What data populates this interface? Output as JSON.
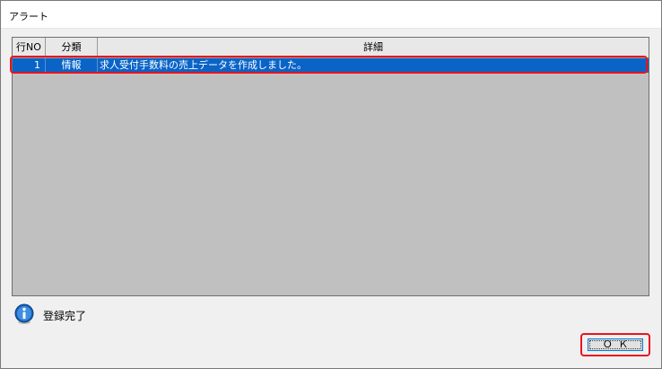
{
  "window": {
    "title": "アラート"
  },
  "grid": {
    "columns": [
      "行NO",
      "分類",
      "詳細"
    ],
    "rows": [
      {
        "no": "1",
        "category": "情報",
        "detail": "求人受付手数料の売上データを作成しました。"
      }
    ]
  },
  "status": {
    "icon": "info-icon",
    "text": "登録完了"
  },
  "buttons": {
    "ok_label": "Ｏ Ｋ"
  },
  "colors": {
    "selection": "#0a64c8",
    "highlight_box": "#e8141e",
    "grid_bg": "#c0c0c0"
  }
}
